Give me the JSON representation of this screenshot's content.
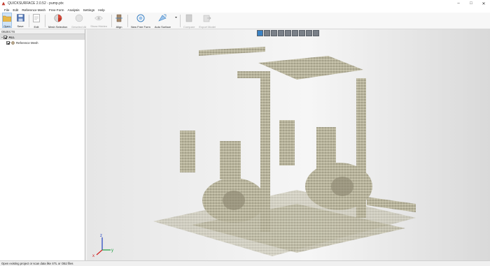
{
  "window": {
    "title": "QUICKSURFACE 2.0.52 - pump.ptx"
  },
  "menu": [
    "File",
    "Edit",
    "Reference Mesh",
    "Free Form",
    "Analysis",
    "Settings",
    "Help"
  ],
  "toolbar": {
    "open": "Open",
    "save": "Save",
    "edit": "Edit",
    "mesh_selection": "Mesh Selection",
    "deselect_all": "Deselect All",
    "show_hidden": "Show Hidden",
    "align": "Align",
    "new_free_form": "New Free Form",
    "auto_surface": "Auto Surface",
    "compare": "Compare",
    "export_model": "Export Model"
  },
  "objects_panel": {
    "header": "OBJECTS",
    "all_label": "ALL",
    "items": [
      {
        "label": "Reference Mesh"
      }
    ]
  },
  "axes": {
    "z": "z",
    "x": "x",
    "y": "y"
  },
  "status": "Open existing project or scan data like STL or OBJ files",
  "colors": {
    "accent": "#3b82c4",
    "point_cloud": "#b7b39a"
  }
}
